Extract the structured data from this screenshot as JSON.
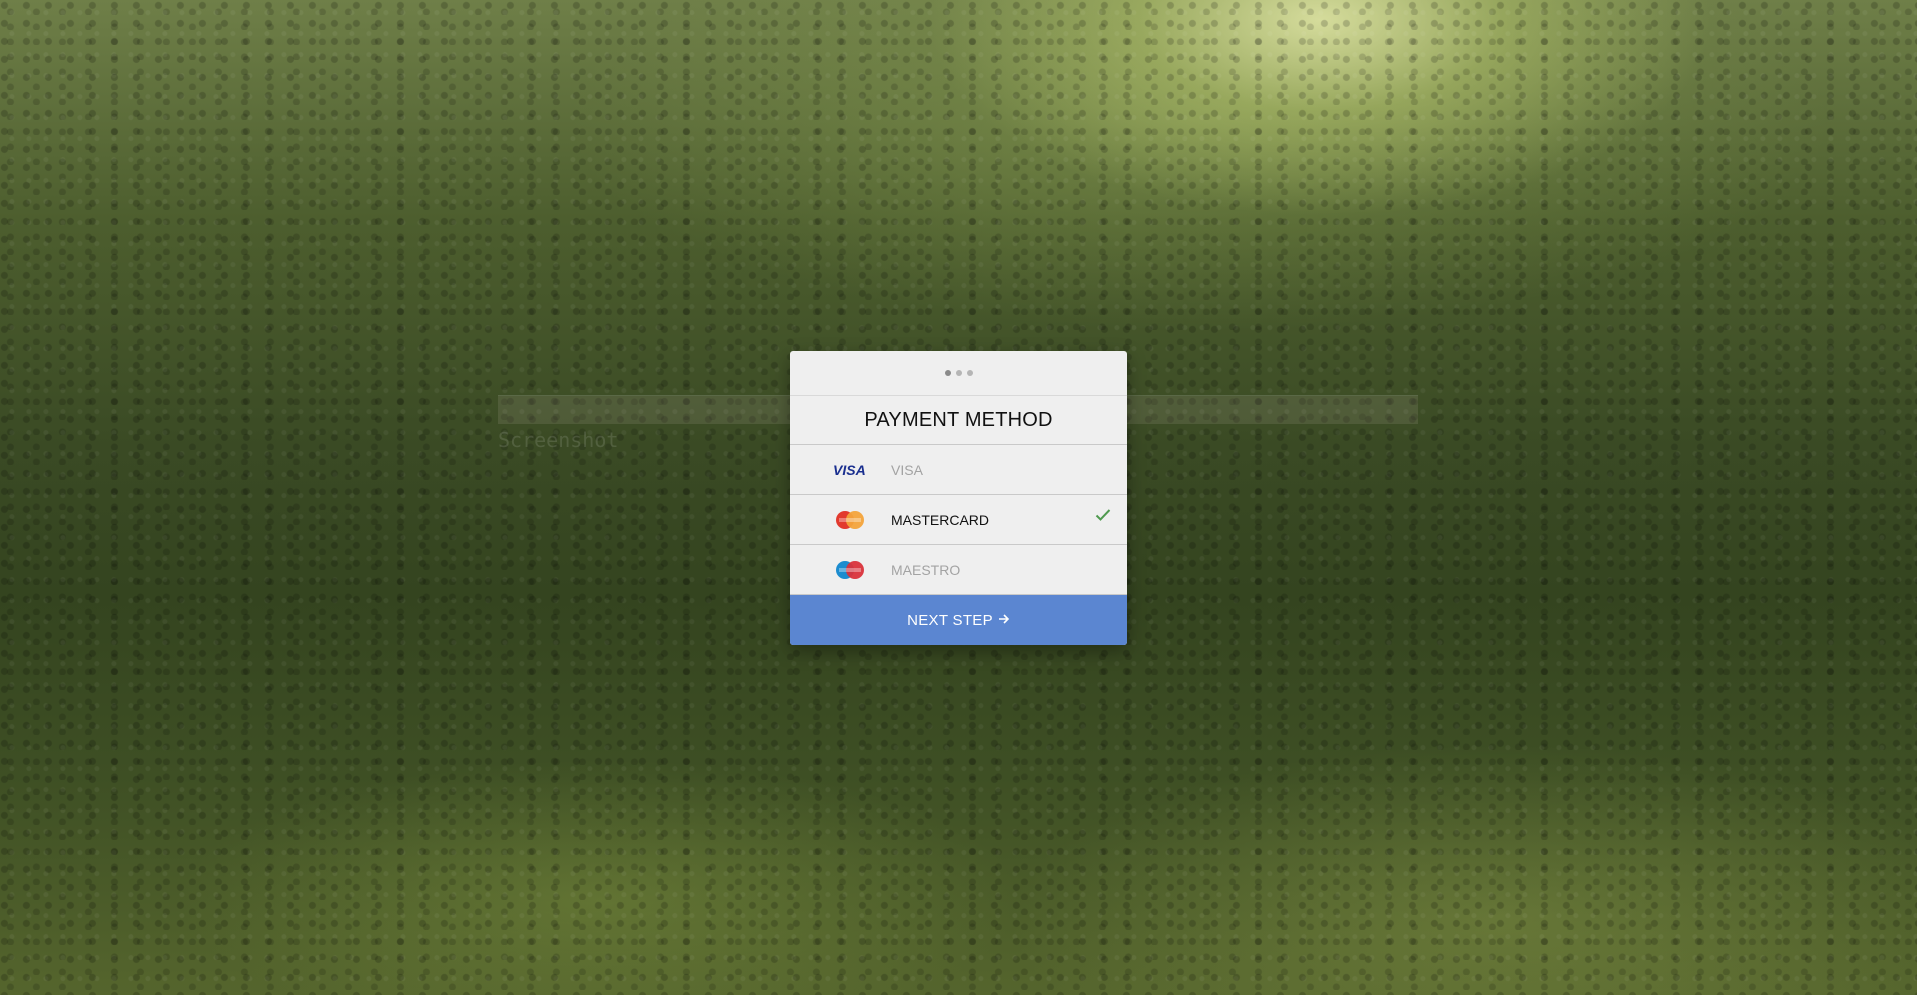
{
  "background": {
    "description_colors": {
      "forest_dark": "#3a4a24",
      "sunlight": "#e6ebaa"
    }
  },
  "ghost_text": {
    "line1": "...  ...",
    "line2": "...  ...",
    "line3": "Screenshot"
  },
  "card": {
    "steps": [
      {
        "state": "current"
      },
      {
        "state": "upcoming"
      },
      {
        "state": "upcoming"
      }
    ],
    "title": "PAYMENT METHOD",
    "options": [
      {
        "label": "VISA",
        "icon": "visa-logo-icon",
        "selected": false
      },
      {
        "label": "MASTERCARD",
        "icon": "mastercard-logo-icon",
        "selected": true
      },
      {
        "label": "MAESTRO",
        "icon": "maestro-logo-icon",
        "selected": false
      }
    ],
    "next_button": {
      "label": "NEXT STEP",
      "icon": "arrow-right-icon"
    },
    "colors": {
      "accent": "#5b86d1",
      "check": "#4f9a4f",
      "selected_text": "#111111",
      "unselected_text": "#a3a3a3"
    }
  }
}
